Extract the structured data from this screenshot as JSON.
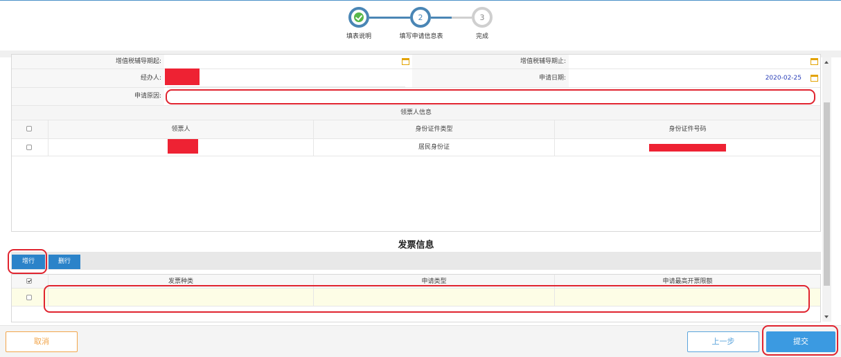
{
  "stepper": {
    "steps": [
      {
        "number": "",
        "label": "填表说明",
        "state": "done"
      },
      {
        "number": "2",
        "label": "填写申请信息表",
        "state": "active"
      },
      {
        "number": "3",
        "label": "完成",
        "state": "pending"
      }
    ]
  },
  "form": {
    "vat_period_start_label": "增值税辅导期起:",
    "vat_period_start_value": "",
    "vat_period_end_label": "增值税辅导期止:",
    "vat_period_end_value": "",
    "handler_label": "经办人:",
    "handler_value": "",
    "apply_date_label": "申请日期:",
    "apply_date_value": "2020-02-25",
    "reason_label": "申请原因:",
    "reason_value": ""
  },
  "receiver": {
    "section_title": "领票人信息",
    "columns": [
      "领票人",
      "身份证件类型",
      "身份证件号码"
    ],
    "rows": [
      {
        "name": "",
        "id_type": "居民身份证",
        "id_number": ""
      }
    ]
  },
  "invoice": {
    "section_title": "发票信息",
    "add_row_label": "增行",
    "delete_row_label": "删行",
    "columns": [
      "发票种类",
      "申请类型",
      "申请最高开票限额"
    ],
    "rows": [
      {
        "type": "",
        "apply_type": "",
        "max_amount": ""
      }
    ]
  },
  "footer": {
    "cancel_label": "取消",
    "prev_label": "上一步",
    "submit_label": "提交"
  },
  "colors": {
    "accent": "#3b9ae1",
    "step_done": "#58b74a",
    "cancel": "#f2a54a",
    "annotation": "#e0232e",
    "redaction": "#ee2233"
  }
}
